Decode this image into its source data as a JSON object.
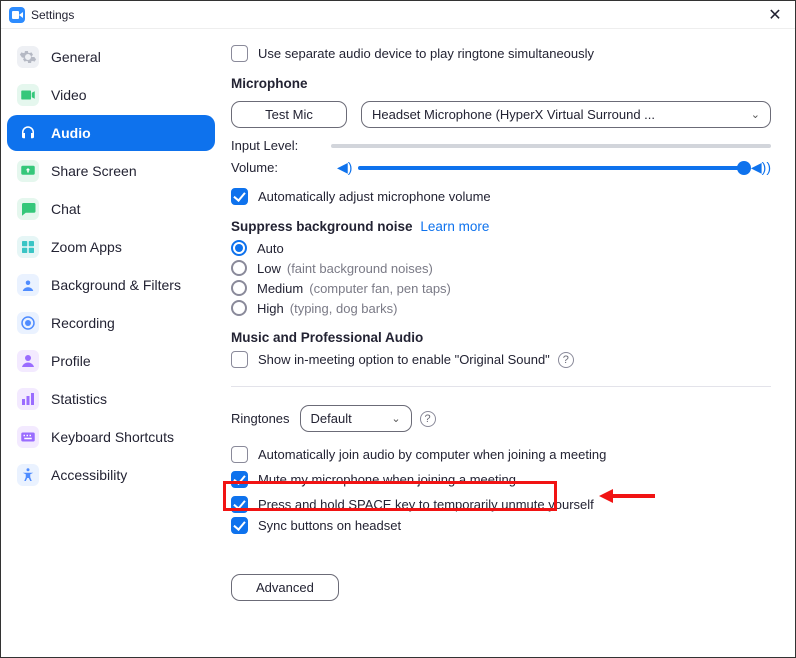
{
  "window": {
    "title": "Settings"
  },
  "sidebar": {
    "items": [
      {
        "key": "general",
        "label": "General"
      },
      {
        "key": "video",
        "label": "Video"
      },
      {
        "key": "audio",
        "label": "Audio",
        "active": true
      },
      {
        "key": "share-screen",
        "label": "Share Screen"
      },
      {
        "key": "chat",
        "label": "Chat"
      },
      {
        "key": "zoom-apps",
        "label": "Zoom Apps"
      },
      {
        "key": "background-filters",
        "label": "Background & Filters"
      },
      {
        "key": "recording",
        "label": "Recording"
      },
      {
        "key": "profile",
        "label": "Profile"
      },
      {
        "key": "statistics",
        "label": "Statistics"
      },
      {
        "key": "keyboard-shortcuts",
        "label": "Keyboard Shortcuts"
      },
      {
        "key": "accessibility",
        "label": "Accessibility"
      }
    ]
  },
  "audio": {
    "separate_ringtone": "Use separate audio device to play ringtone simultaneously",
    "mic_heading": "Microphone",
    "test_mic": "Test Mic",
    "mic_device": "Headset Microphone (HyperX Virtual Surround ...",
    "input_level_label": "Input Level:",
    "volume_label": "Volume:",
    "auto_volume": "Automatically adjust microphone volume",
    "suppress_heading": "Suppress background noise",
    "learn_more": "Learn more",
    "noise": {
      "auto": "Auto",
      "low": "Low",
      "low_hint": "(faint background noises)",
      "medium": "Medium",
      "medium_hint": "(computer fan, pen taps)",
      "high": "High",
      "high_hint": "(typing, dog barks)"
    },
    "music_heading": "Music and Professional Audio",
    "original_sound": "Show in-meeting option to enable \"Original Sound\"",
    "ringtones_label": "Ringtones",
    "ringtones_value": "Default",
    "auto_join": "Automatically join audio by computer when joining a meeting",
    "mute_on_join": "Mute my microphone when joining a meeting",
    "press_space": "Press and hold SPACE key to temporarily unmute yourself",
    "sync_headset": "Sync buttons on headset",
    "advanced": "Advanced"
  }
}
